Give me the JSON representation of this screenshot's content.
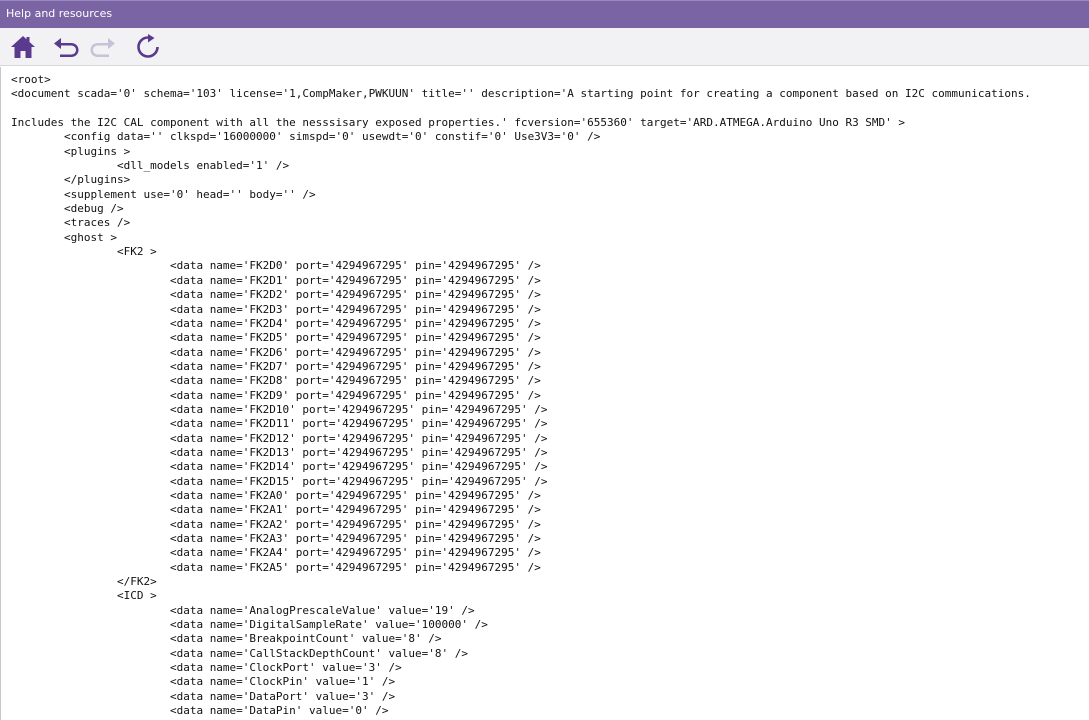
{
  "window": {
    "title": "Help and resources"
  },
  "toolbar": {
    "buttons": [
      {
        "icon": "home-icon"
      },
      {
        "icon": "undo-icon"
      },
      {
        "icon": "redo-icon"
      },
      {
        "icon": "refresh-icon"
      }
    ]
  },
  "colors": {
    "titlebar": "#7a64a4",
    "icon": "#5a3a8e",
    "icon_disabled": "#c8c2d8"
  },
  "content": {
    "lines": [
      "<root>",
      "<document scada='0' schema='103' license='1,CompMaker,PWKUUN' title='' description='A starting point for creating a component based on I2C communications.",
      "",
      "Includes the I2C CAL component with all the nesssisary exposed properties.' fcversion='655360' target='ARD.ATMEGA.Arduino Uno R3 SMD' >",
      "\t<config data='' clkspd='16000000' simspd='0' usewdt='0' constif='0' Use3V3='0' />",
      "\t<plugins >",
      "\t\t<dll_models enabled='1' />",
      "\t</plugins>",
      "\t<supplement use='0' head='' body='' />",
      "\t<debug />",
      "\t<traces />",
      "\t<ghost >",
      "\t\t<FK2 >",
      "\t\t\t<data name='FK2D0' port='4294967295' pin='4294967295' />",
      "\t\t\t<data name='FK2D1' port='4294967295' pin='4294967295' />",
      "\t\t\t<data name='FK2D2' port='4294967295' pin='4294967295' />",
      "\t\t\t<data name='FK2D3' port='4294967295' pin='4294967295' />",
      "\t\t\t<data name='FK2D4' port='4294967295' pin='4294967295' />",
      "\t\t\t<data name='FK2D5' port='4294967295' pin='4294967295' />",
      "\t\t\t<data name='FK2D6' port='4294967295' pin='4294967295' />",
      "\t\t\t<data name='FK2D7' port='4294967295' pin='4294967295' />",
      "\t\t\t<data name='FK2D8' port='4294967295' pin='4294967295' />",
      "\t\t\t<data name='FK2D9' port='4294967295' pin='4294967295' />",
      "\t\t\t<data name='FK2D10' port='4294967295' pin='4294967295' />",
      "\t\t\t<data name='FK2D11' port='4294967295' pin='4294967295' />",
      "\t\t\t<data name='FK2D12' port='4294967295' pin='4294967295' />",
      "\t\t\t<data name='FK2D13' port='4294967295' pin='4294967295' />",
      "\t\t\t<data name='FK2D14' port='4294967295' pin='4294967295' />",
      "\t\t\t<data name='FK2D15' port='4294967295' pin='4294967295' />",
      "\t\t\t<data name='FK2A0' port='4294967295' pin='4294967295' />",
      "\t\t\t<data name='FK2A1' port='4294967295' pin='4294967295' />",
      "\t\t\t<data name='FK2A2' port='4294967295' pin='4294967295' />",
      "\t\t\t<data name='FK2A3' port='4294967295' pin='4294967295' />",
      "\t\t\t<data name='FK2A4' port='4294967295' pin='4294967295' />",
      "\t\t\t<data name='FK2A5' port='4294967295' pin='4294967295' />",
      "\t\t</FK2>",
      "\t\t<ICD >",
      "\t\t\t<data name='AnalogPrescaleValue' value='19' />",
      "\t\t\t<data name='DigitalSampleRate' value='100000' />",
      "\t\t\t<data name='BreakpointCount' value='8' />",
      "\t\t\t<data name='CallStackDepthCount' value='8' />",
      "\t\t\t<data name='ClockPort' value='3' />",
      "\t\t\t<data name='ClockPin' value='1' />",
      "\t\t\t<data name='DataPort' value='3' />",
      "\t\t\t<data name='DataPin' value='0' />"
    ]
  }
}
